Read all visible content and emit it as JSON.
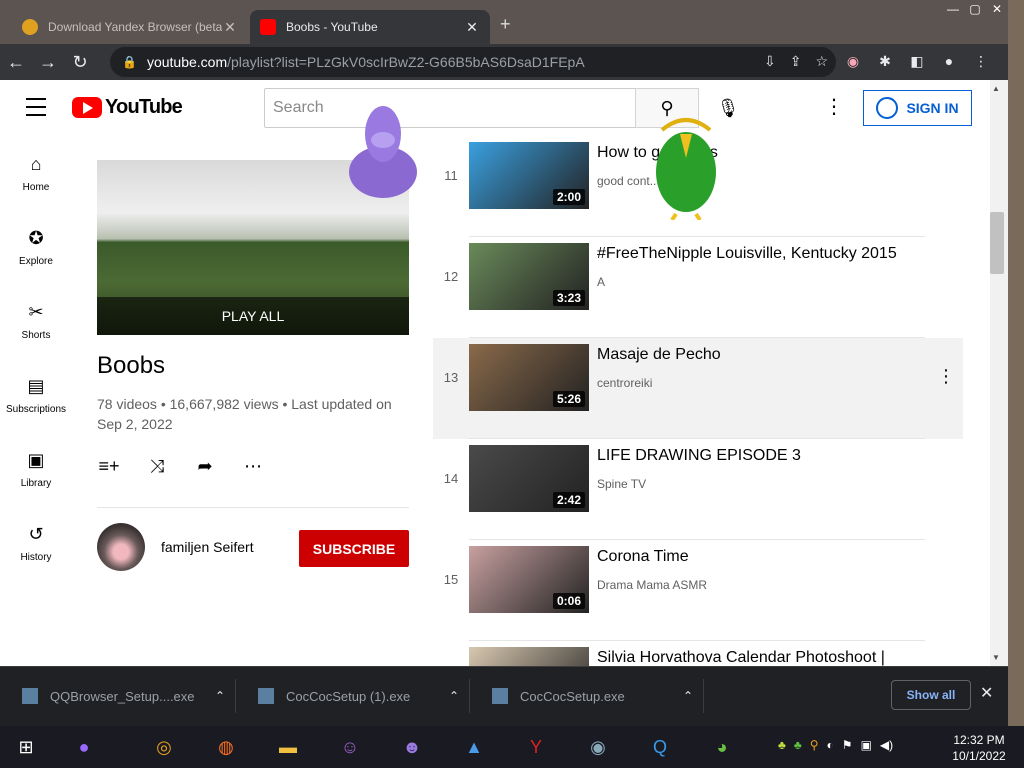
{
  "tabs": [
    {
      "title": "Download Yandex Browser (beta)",
      "active": false
    },
    {
      "title": "Boobs - YouTube",
      "active": true
    }
  ],
  "address": {
    "host": "youtube.com",
    "path": "/playlist?list=PLzGkV0scIrBwZ2-G66B5bAS6DsaD1FEpA"
  },
  "header": {
    "search_placeholder": "Search",
    "signin_label": "SIGN IN"
  },
  "guide": [
    {
      "label": "Home",
      "icon": "home-icon",
      "glyph": "⌂"
    },
    {
      "label": "Explore",
      "icon": "compass-icon",
      "glyph": "✪"
    },
    {
      "label": "Shorts",
      "icon": "shorts-icon",
      "glyph": "✂"
    },
    {
      "label": "Subscriptions",
      "icon": "subscriptions-icon",
      "glyph": "▤"
    },
    {
      "label": "Library",
      "icon": "library-icon",
      "glyph": "▣"
    },
    {
      "label": "History",
      "icon": "history-icon",
      "glyph": "↺"
    }
  ],
  "playlist": {
    "play_all": "PLAY ALL",
    "title": "Boobs",
    "meta": "78 videos • 16,667,982 views • Last updated on Sep 2, 2022",
    "owner": "familjen Seifert",
    "subscribe": "SUBSCRIBE"
  },
  "videos": [
    {
      "index": "11",
      "title": "How to g... views",
      "channel": "good cont...",
      "duration": "2:00",
      "thumb": "#3aa0e0"
    },
    {
      "index": "12",
      "title": "#FreeTheNipple Louisville, Kentucky 2015",
      "channel": "A",
      "duration": "3:23",
      "thumb": "#6a8a5a"
    },
    {
      "index": "13",
      "title": "Masaje de Pecho",
      "channel": "centroreiki",
      "duration": "5:26",
      "thumb": "#8a6a4a"
    },
    {
      "index": "14",
      "title": "LIFE DRAWING EPISODE 3",
      "channel": "Spine TV",
      "duration": "2:42",
      "thumb": "#4a4a4a"
    },
    {
      "index": "15",
      "title": "Corona Time",
      "channel": "Drama Mama ASMR",
      "duration": "0:06",
      "thumb": "#c8a0a0"
    },
    {
      "index": "",
      "title": "Silvia Horvathova Calendar Photoshoot |",
      "channel": "",
      "duration": "",
      "thumb": "#d8c8b0"
    }
  ],
  "downloads": [
    {
      "name": "QQBrowser_Setup....exe"
    },
    {
      "name": "CocCocSetup (1).exe"
    },
    {
      "name": "CocCocSetup.exe"
    }
  ],
  "downloads_show_all": "Show all",
  "clock": {
    "time": "12:32 PM",
    "date": "10/1/2022"
  },
  "colors": {
    "yt_red": "#ff0000",
    "subscribe_red": "#cc0000",
    "link_blue": "#065fd4",
    "chrome_dark": "#202124"
  }
}
